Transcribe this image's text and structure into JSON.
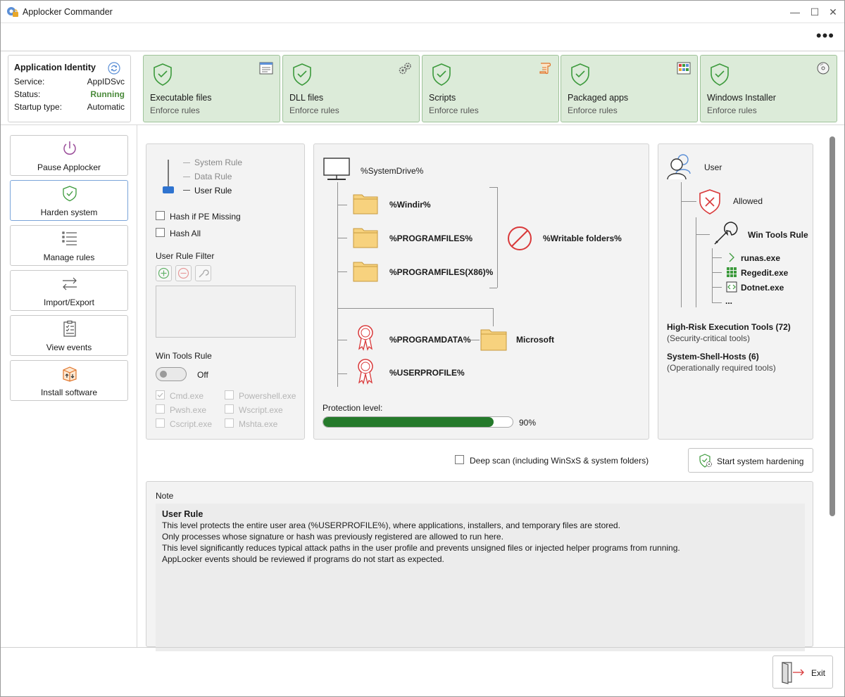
{
  "app": {
    "title": "Applocker Commander",
    "min_glyph": "—",
    "max_glyph": "☐",
    "close_glyph": "✕",
    "more_glyph": "•••"
  },
  "identity": {
    "title": "Application Identity",
    "rows": [
      {
        "key": "Service:",
        "value": "AppIDSvc"
      },
      {
        "key": "Status:",
        "value": "Running"
      },
      {
        "key": "Startup type:",
        "value": "Automatic"
      }
    ]
  },
  "tiles": [
    {
      "name": "Executable files",
      "status": "Enforce rules",
      "icon": "window-icon"
    },
    {
      "name": "DLL files",
      "status": "Enforce rules",
      "icon": "gears-icon"
    },
    {
      "name": "Scripts",
      "status": "Enforce rules",
      "icon": "scroll-icon"
    },
    {
      "name": "Packaged apps",
      "status": "Enforce rules",
      "icon": "apps-icon"
    },
    {
      "name": "Windows Installer",
      "status": "Enforce rules",
      "icon": "disc-icon"
    }
  ],
  "nav": [
    {
      "label": "Pause Applocker",
      "icon": "power-icon"
    },
    {
      "label": "Harden system",
      "icon": "shield-icon"
    },
    {
      "label": "Manage rules",
      "icon": "list-icon"
    },
    {
      "label": "Import/Export",
      "icon": "arrows-icon"
    },
    {
      "label": "View events",
      "icon": "clipboard-icon"
    },
    {
      "label": "Install software",
      "icon": "package-icon"
    }
  ],
  "levels": {
    "items": [
      "System Rule",
      "Data Rule",
      "User Rule"
    ],
    "selected": "User Rule"
  },
  "options": {
    "hash_pe_missing": "Hash if PE Missing",
    "hash_all": "Hash All",
    "filter_label": "User Rule Filter",
    "win_tools_label": "Win Tools Rule",
    "toggle_state": "Off",
    "tools": [
      "Cmd.exe",
      "Powershell.exe",
      "Pwsh.exe",
      "Wscript.exe",
      "Cscript.exe",
      "Mshta.exe"
    ]
  },
  "tree": {
    "root": "%SystemDrive%",
    "windir": "%Windir%",
    "programfiles": "%PROGRAMFILES%",
    "programfiles86": "%PROGRAMFILES(X86)%",
    "writable": "%Writable folders%",
    "programdata": "%PROGRAMDATA%",
    "microsoft": "Microsoft",
    "userprofile": "%USERPROFILE%",
    "protection_label": "Protection level:",
    "protection_value": 90,
    "protection_text": "90%"
  },
  "user_panel": {
    "user": "User",
    "allowed": "Allowed",
    "win_tools_rule": "Win Tools Rule",
    "exes": [
      "runas.exe",
      "Regedit.exe",
      "Dotnet.exe",
      "..."
    ],
    "group1_title": "High-Risk Execution Tools (72)",
    "group1_sub": "(Security-critical tools)",
    "group2_title": "System-Shell-Hosts (6)",
    "group2_sub": "(Operationally required tools)"
  },
  "actions": {
    "deep_scan": "Deep scan (including WinSxS & system folders)",
    "start_hardening": "Start system hardening",
    "exit": "Exit"
  },
  "note": {
    "header": "Note",
    "title": "User Rule",
    "lines": [
      "This level protects the entire user area (%USERPROFILE%), where applications, installers, and temporary files are stored.",
      "Only processes whose signature or hash was previously registered are allowed to run here.",
      "This level significantly reduces typical attack paths in the user profile and prevents unsigned files or injected helper programs from running.",
      "AppLocker events should be reviewed if programs do not start as expected."
    ]
  },
  "colors": {
    "tile_bg": "#dcebd9",
    "shield_green": "#3c9a3c",
    "running": "#4a8a3a",
    "progress": "#257a2b",
    "deny_red": "#d9393a",
    "folder": "#f7d27e"
  }
}
